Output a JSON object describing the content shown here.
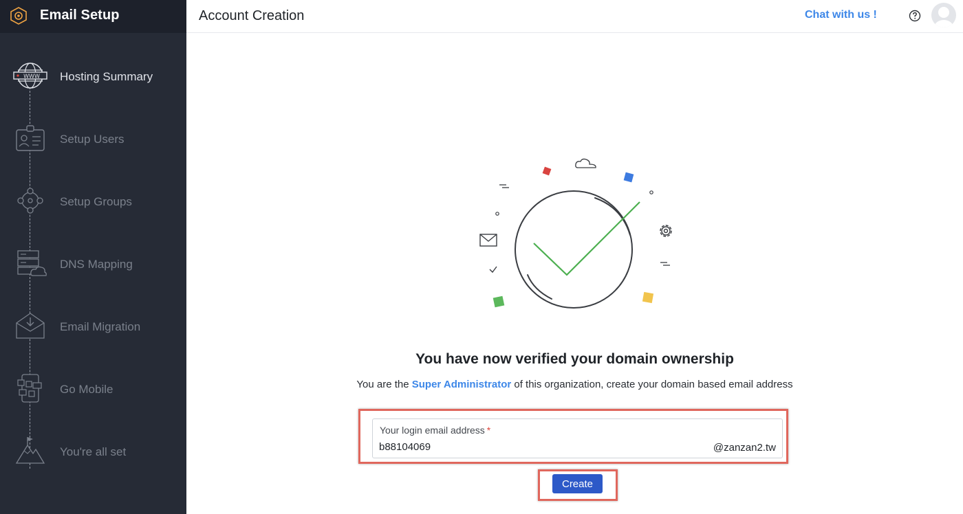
{
  "app": {
    "title": "Email Setup"
  },
  "sidebar": {
    "steps": [
      {
        "label": "Hosting Summary",
        "icon": "globe-www-icon",
        "active": true
      },
      {
        "label": "Setup Users",
        "icon": "id-card-icon",
        "active": false
      },
      {
        "label": "Setup Groups",
        "icon": "group-network-icon",
        "active": false
      },
      {
        "label": "DNS Mapping",
        "icon": "server-cloud-icon",
        "active": false
      },
      {
        "label": "Email Migration",
        "icon": "inbox-download-icon",
        "active": false
      },
      {
        "label": "Go Mobile",
        "icon": "mobile-apps-icon",
        "active": false
      },
      {
        "label": "You're all set",
        "icon": "mountain-flag-icon",
        "active": false
      }
    ]
  },
  "header": {
    "title": "Account Creation",
    "chat_label": "Chat with us !",
    "help_icon": "question-circle-icon",
    "avatar_icon": "user-avatar-icon"
  },
  "main": {
    "headline": "You have now verified your domain ownership",
    "sub_prefix": "You are the",
    "sub_highlight": "Super Administrator",
    "sub_suffix": "of this organization, create your domain based email address",
    "email_field": {
      "label": "Your login email address",
      "required_mark": "*",
      "value": "b88104069",
      "domain_suffix": "@zanzan2.tw"
    },
    "create_label": "Create"
  },
  "colors": {
    "sidebar_bg": "#262b36",
    "accent_blue": "#3d87e8",
    "button_blue": "#2d59c8",
    "check_green": "#4caf50",
    "highlight_red": "#e0675d"
  }
}
